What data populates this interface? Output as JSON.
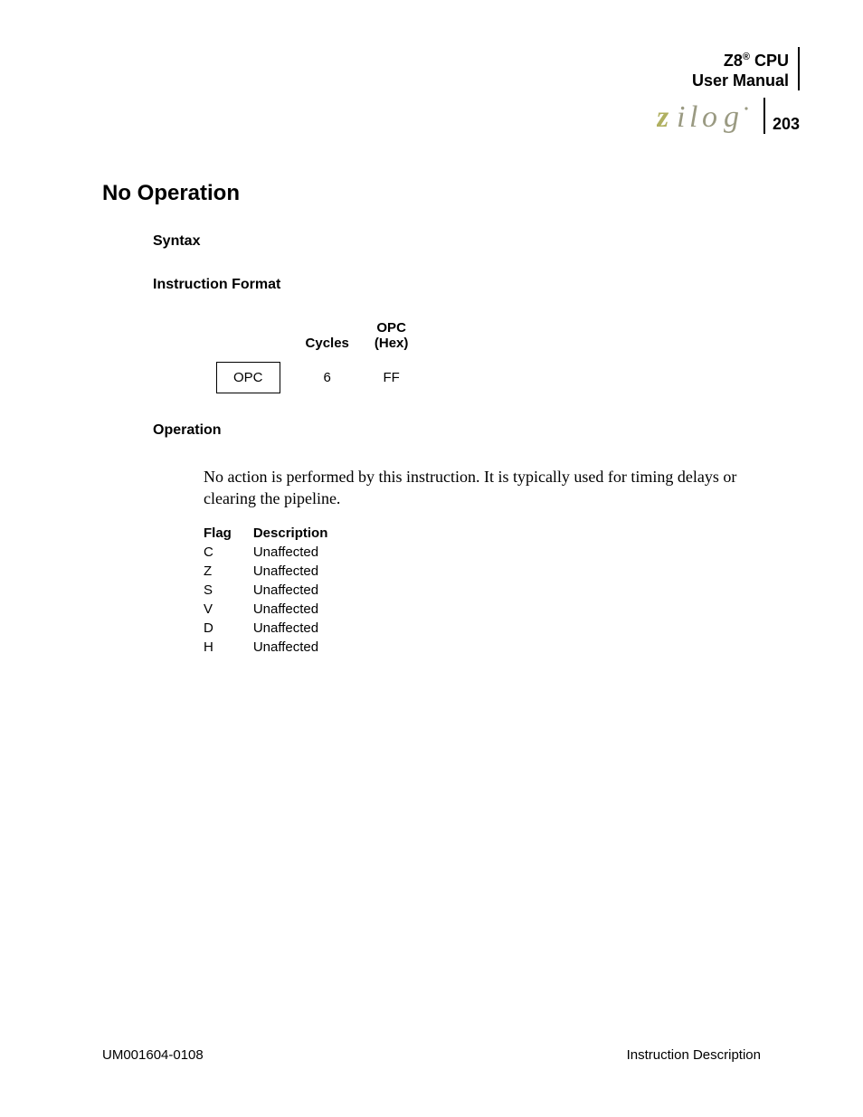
{
  "header": {
    "product_line1_pre": "Z8",
    "product_line1_sup": "®",
    "product_line1_post": " CPU",
    "product_line2": "User Manual",
    "page_number": "203"
  },
  "title": "No Operation",
  "sections": {
    "syntax_label": "Syntax",
    "instr_format_label": "Instruction Format",
    "operation_label": "Operation"
  },
  "instr_format": {
    "col_cycles": "Cycles",
    "col_opc_hex_l1": "OPC",
    "col_opc_hex_l2": "(Hex)",
    "box_label": "OPC",
    "cycles_val": "6",
    "opc_hex_val": "FF"
  },
  "operation_text": "No action is performed by this instruction. It is typically used for timing delays or clearing the pipeline.",
  "flag_table": {
    "head_flag": "Flag",
    "head_desc": "Description",
    "rows": [
      {
        "flag": "C",
        "desc": "Unaffected"
      },
      {
        "flag": "Z",
        "desc": "Unaffected"
      },
      {
        "flag": "S",
        "desc": "Unaffected"
      },
      {
        "flag": "V",
        "desc": "Unaffected"
      },
      {
        "flag": "D",
        "desc": "Unaffected"
      },
      {
        "flag": "H",
        "desc": "Unaffected"
      }
    ]
  },
  "footer": {
    "left": "UM001604-0108",
    "right": "Instruction Description"
  }
}
